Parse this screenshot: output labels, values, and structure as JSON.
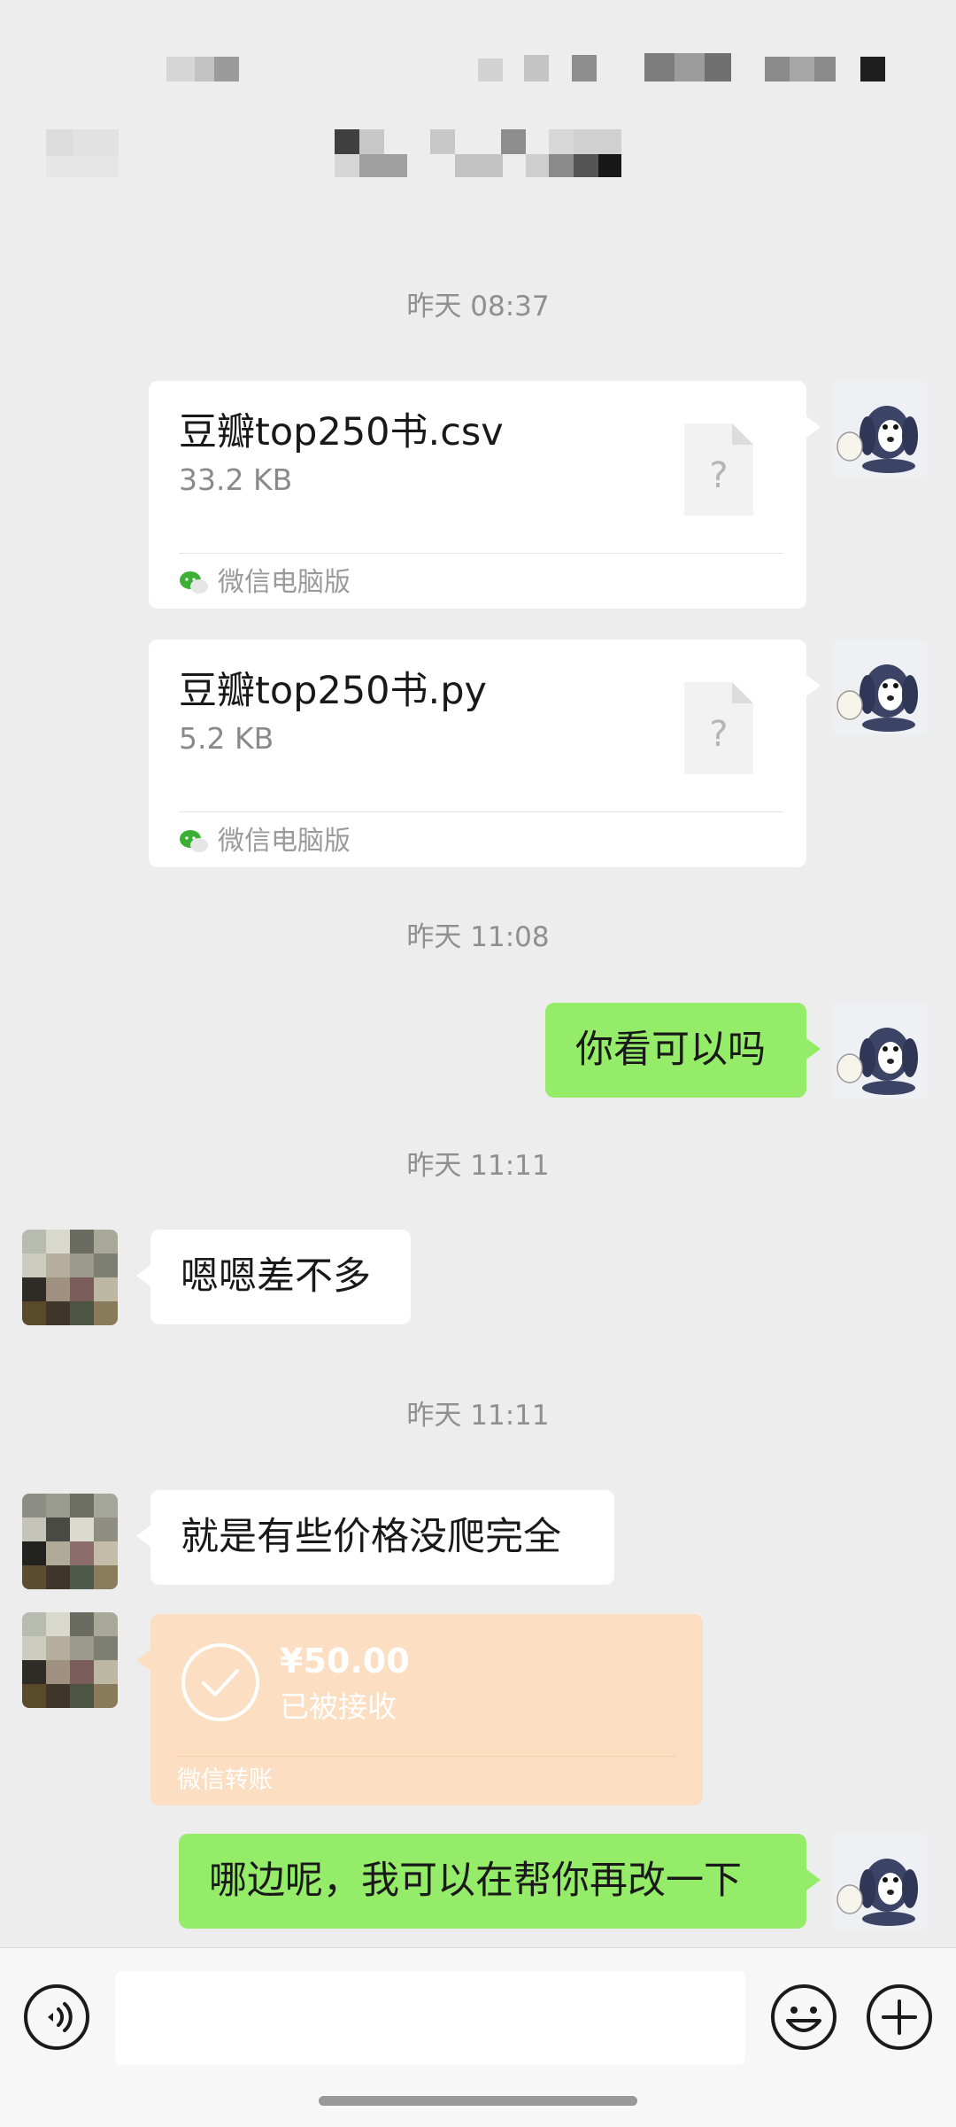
{
  "messages": [
    {
      "timestamp": "昨天 08:37",
      "file_name": "豆瓣top250书.csv",
      "file_size": "33.2 KB",
      "file_source": "微信电脑版"
    },
    {
      "file_name": "豆瓣top250书.py",
      "file_size": "5.2 KB",
      "file_source": "微信电脑版"
    },
    {
      "timestamp": "昨天 11:08",
      "text": "你看可以吗"
    },
    {
      "timestamp": "昨天 11:11",
      "text": "嗯嗯差不多"
    },
    {
      "timestamp": "昨天 11:11",
      "text": "就是有些价格没爬完全"
    },
    {
      "transfer_amount": "¥50.00",
      "transfer_status": "已被接收",
      "transfer_label": "微信转账"
    },
    {
      "text": "哪边呢，我可以在帮你再改一下"
    }
  ],
  "file_icon_glyph": "?",
  "input": {
    "value": "",
    "placeholder": ""
  },
  "icons": [
    "voice-icon",
    "emoji-icon",
    "plus-icon",
    "wechat-pc-icon",
    "check-icon",
    "file-unknown-icon"
  ],
  "colors": {
    "background": "#ededed",
    "sent_bubble": "#95ec69",
    "received_bubble": "#ffffff",
    "transfer_card": "#fcdfc2",
    "timestamp": "#8f8f8f"
  }
}
